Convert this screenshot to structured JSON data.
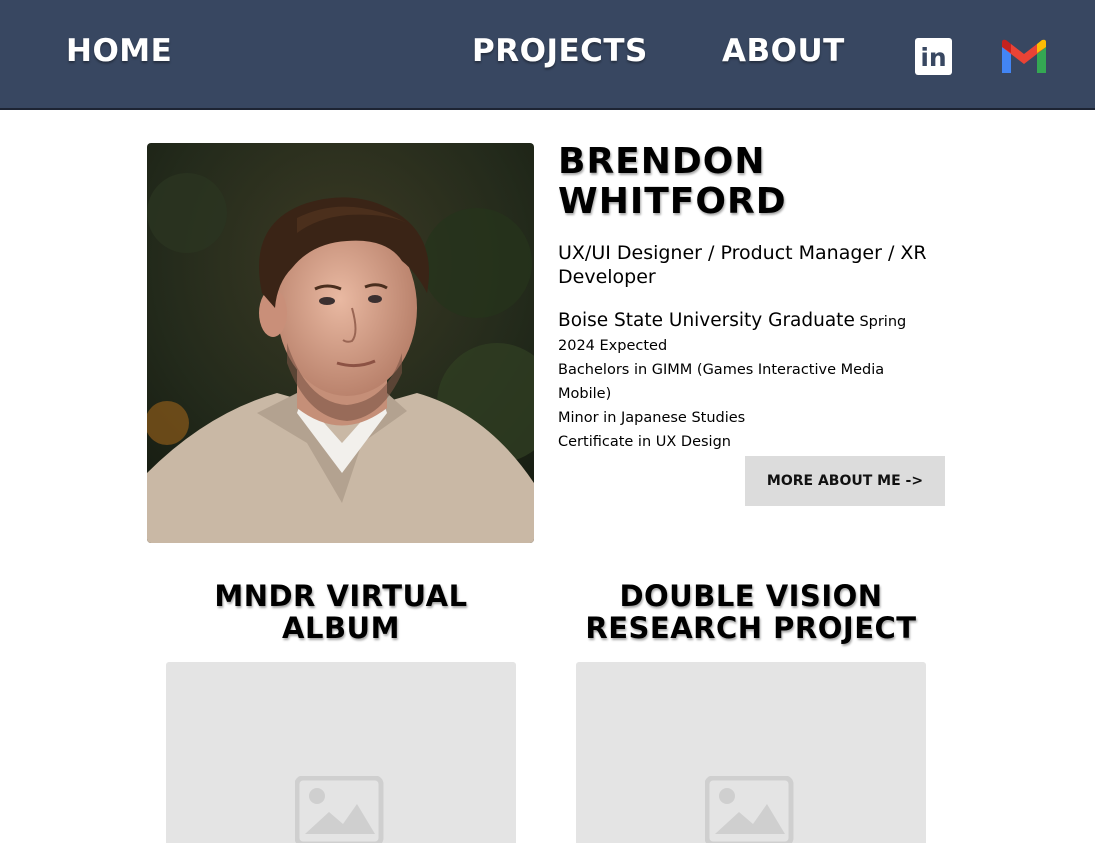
{
  "nav": {
    "home": "HOME",
    "projects": "PROJECTS",
    "about": "ABOUT",
    "linkedin_icon": "linkedin-icon",
    "gmail_icon": "gmail-icon",
    "linkedin_letters": "in"
  },
  "profile": {
    "name": "BRENDON WHITFORD",
    "roles": "UX/UI Designer / Product Manager / XR Developer",
    "school": "Boise State University Graduate",
    "expected": "Spring 2024 Expected",
    "degree": "Bachelors in GIMM (Games Interactive Media Mobile)",
    "minor": "Minor in Japanese Studies",
    "certificate": "Certificate in UX Design",
    "more_button": "MORE ABOUT ME ->"
  },
  "projects": [
    {
      "title": "MNDR VIRTUAL ALBUM"
    },
    {
      "title": "DOUBLE VISION RESEARCH PROJECT"
    }
  ],
  "colors": {
    "nav_bg": "#384761",
    "button_bg": "#dcdcdc",
    "placeholder_bg": "#e4e4e4"
  }
}
